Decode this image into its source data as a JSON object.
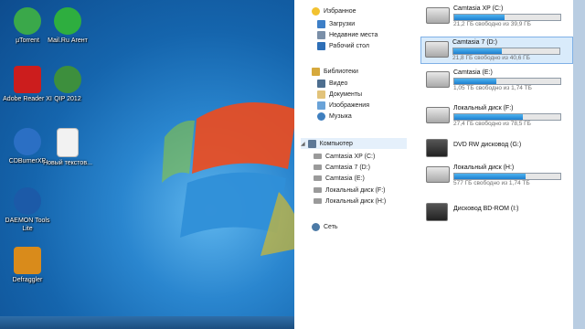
{
  "desktop": {
    "icons": [
      {
        "label": "µTorrent",
        "name": "utorrent-icon",
        "color": "#3aa84a"
      },
      {
        "label": "Mail.Ru Агент",
        "name": "mailru-agent-icon",
        "color": "#2eae3f"
      },
      {
        "label": "Adobe Reader XI",
        "name": "adobe-reader-icon",
        "color": "#cc1d1d"
      },
      {
        "label": "QIP 2012",
        "name": "qip-icon",
        "color": "#3d8f3d"
      },
      {
        "label": "CDBurnerXP",
        "name": "cdburnerxp-icon",
        "color": "#2b6fc4"
      },
      {
        "label": "Новый текстов...",
        "name": "text-document-icon",
        "color": "#f2f2f2"
      },
      {
        "label": "DAEMON Tools Lite",
        "name": "daemon-tools-icon",
        "color": "#1c5aa8"
      },
      {
        "label": "Defraggler",
        "name": "defraggler-icon",
        "color": "#d98b1b"
      }
    ]
  },
  "nav": {
    "favorites": {
      "header": "Избранное",
      "items": [
        "Загрузки",
        "Недавние места",
        "Рабочий стол"
      ]
    },
    "libraries": {
      "header": "Библиотеки",
      "items": [
        "Видео",
        "Документы",
        "Изображения",
        "Музыка"
      ]
    },
    "computer": {
      "header": "Компьютер",
      "items": [
        "Camtasia XP (C:)",
        "Camtasia 7 (D:)",
        "Camtasia (E:)",
        "Локальный диск (F:)",
        "Локальный диск (H:)"
      ]
    },
    "network": {
      "header": "Сеть"
    }
  },
  "drives": [
    {
      "name": "Camtasia XP (C:)",
      "info": "21,2 ГБ свободно из 39,9 ГБ",
      "used": 0.47,
      "type": "hdd",
      "selected": false
    },
    {
      "name": "Camtasia 7 (D:)",
      "info": "21,8 ГБ свободно из 40,6 ГБ",
      "used": 0.46,
      "type": "hdd",
      "selected": true
    },
    {
      "name": "Camtasia (E:)",
      "info": "1,05 ТБ свободно из 1,74 ТБ",
      "used": 0.4,
      "type": "hdd",
      "selected": false
    },
    {
      "name": "Локальный диск (F:)",
      "info": "27,4 ГБ свободно из 78,5 ГБ",
      "used": 0.65,
      "type": "hdd",
      "selected": false
    },
    {
      "name": "DVD RW дисковод (G:)",
      "info": "",
      "used": null,
      "type": "dvd",
      "selected": false
    },
    {
      "name": "Локальный диск (H:)",
      "info": "577 ГБ свободно из 1,74 ТБ",
      "used": 0.67,
      "type": "hdd",
      "selected": false
    },
    {
      "name": "Дисковод BD-ROM (I:)",
      "info": "",
      "used": null,
      "type": "bd",
      "selected": false
    }
  ]
}
